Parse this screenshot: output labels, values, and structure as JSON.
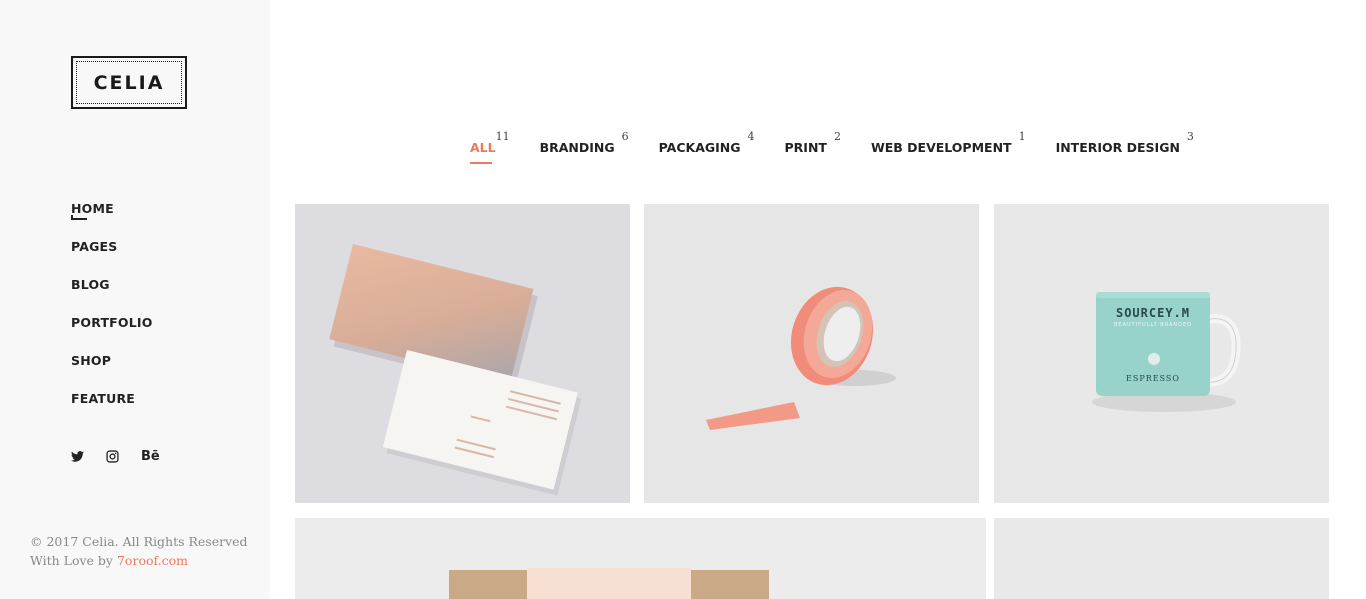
{
  "brand": {
    "logo_text": "CELIA"
  },
  "nav": {
    "items": [
      {
        "label": "HOME",
        "active": true
      },
      {
        "label": "PAGES"
      },
      {
        "label": "BLOG"
      },
      {
        "label": "PORTFOLIO"
      },
      {
        "label": "SHOP"
      },
      {
        "label": "FEATURE"
      }
    ]
  },
  "social": {
    "behance_label": "Bē"
  },
  "footer": {
    "copyright": "© 2017 Celia. All Rights Reserved",
    "love_prefix": "With Love by ",
    "love_link": "7oroof.com"
  },
  "filters": [
    {
      "label": "ALL",
      "count": "11",
      "active": true
    },
    {
      "label": "BRANDING",
      "count": "6"
    },
    {
      "label": "PACKAGING",
      "count": "4"
    },
    {
      "label": "PRINT",
      "count": "2"
    },
    {
      "label": "WEB DEVELOPMENT",
      "count": "1"
    },
    {
      "label": "INTERIOR DESIGN",
      "count": "3"
    }
  ],
  "portfolio": {
    "mug_brand": "SOURCEY.M",
    "mug_tagline": "BEAUTIFULLY BRANDED",
    "mug_product": "ESPRESSO"
  },
  "colors": {
    "accent": "#ee7a5d",
    "sidebar_bg": "#f8f8f8",
    "text": "#222222"
  }
}
